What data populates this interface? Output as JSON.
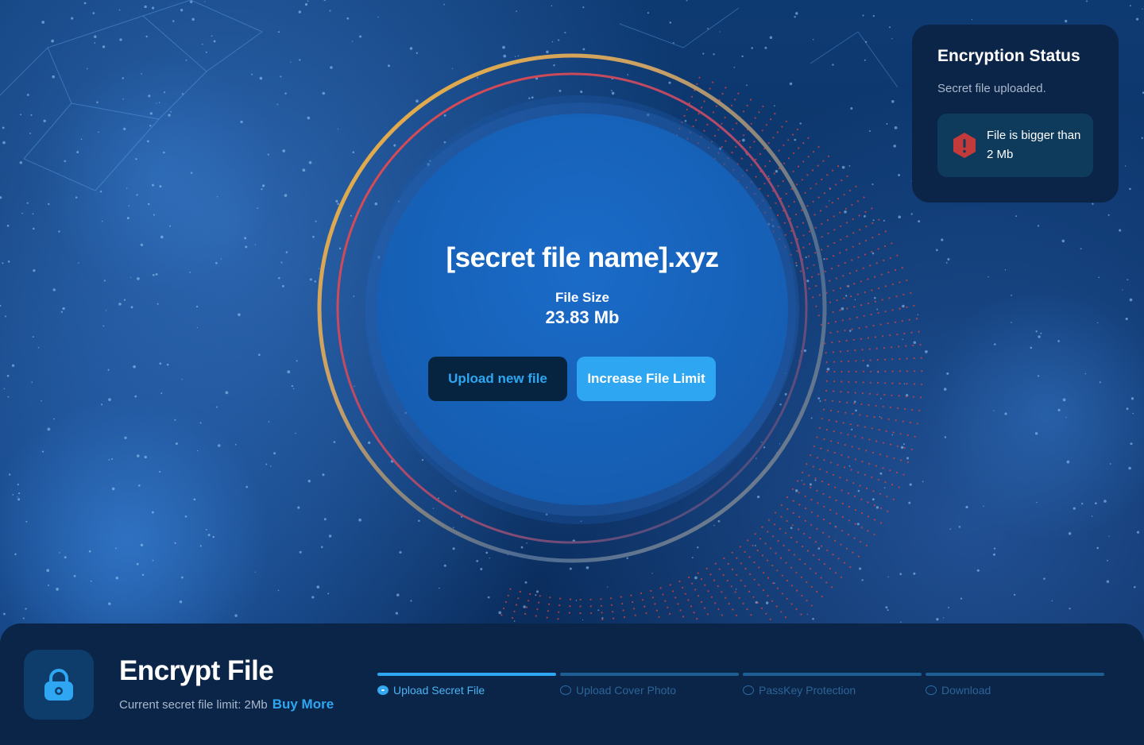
{
  "file": {
    "name": "[secret file name].xyz",
    "size_label": "File Size",
    "size_value": "23.83 Mb"
  },
  "actions": {
    "upload_label": "Upload new file",
    "increase_label": "Increase File Limit"
  },
  "status": {
    "title": "Encryption Status",
    "subtitle": "Secret file uploaded.",
    "alert_icon": "warning-hexagon-icon",
    "alert_line1": "File is bigger than",
    "alert_line2": "2 Mb"
  },
  "footer": {
    "icon": "lock-icon",
    "title": "Encrypt File",
    "limit_text": "Current secret file limit: 2Mb",
    "buy_label": "Buy More"
  },
  "steps": [
    {
      "label": "Upload Secret File",
      "active": true
    },
    {
      "label": "Upload Cover Photo",
      "active": false
    },
    {
      "label": "PassKey Protection",
      "active": false
    },
    {
      "label": "Download",
      "active": false
    }
  ],
  "colors": {
    "accent": "#2ea6f2",
    "panel": "#0b2548",
    "orb": "#1660b6",
    "alert": "#c23a3a"
  }
}
